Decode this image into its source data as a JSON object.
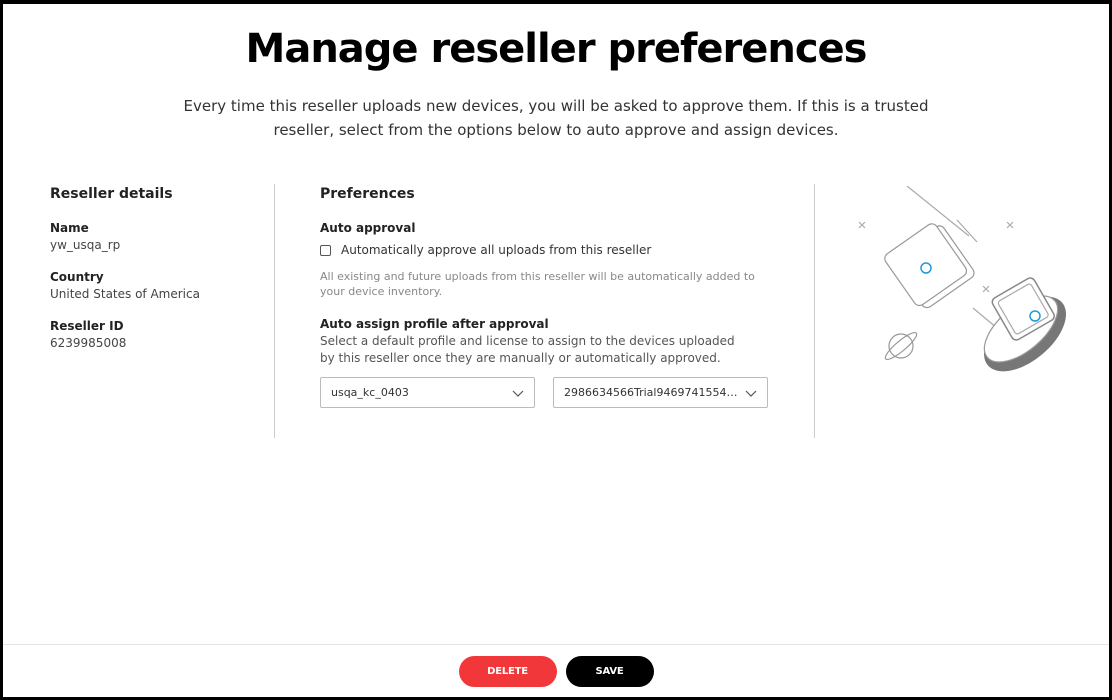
{
  "page": {
    "title": "Manage reseller preferences",
    "subtitle": "Every time this reseller uploads new devices, you will be asked to approve them. If this is a trusted reseller, select from the options below to auto approve and assign devices."
  },
  "reseller": {
    "heading": "Reseller details",
    "name_label": "Name",
    "name_value": "yw_usqa_rp",
    "country_label": "Country",
    "country_value": "United States of America",
    "id_label": "Reseller ID",
    "id_value": "6239985008"
  },
  "preferences": {
    "heading": "Preferences",
    "auto_approval_label": "Auto approval",
    "auto_approval_checkbox_label": "Automatically approve all uploads from this reseller",
    "auto_approval_checked": false,
    "auto_approval_note": "All existing and future uploads from this reseller will be automatically added to your device inventory.",
    "auto_assign_label": "Auto assign profile after approval",
    "auto_assign_desc": "Select a default profile and license to assign to the devices uploaded by this reseller once they are manually or automatically approved.",
    "profile_select_value": "usqa_kc_0403",
    "license_select_value": "2986634566Trial94697415544959..."
  },
  "footer": {
    "delete_label": "DELETE",
    "save_label": "SAVE"
  },
  "colors": {
    "delete_bg": "#f2373b",
    "save_bg": "#000000",
    "accent_blue": "#1e9bd7"
  },
  "icons": {
    "chevron": "chevron-down-icon",
    "illustration": "devices-illustration"
  }
}
